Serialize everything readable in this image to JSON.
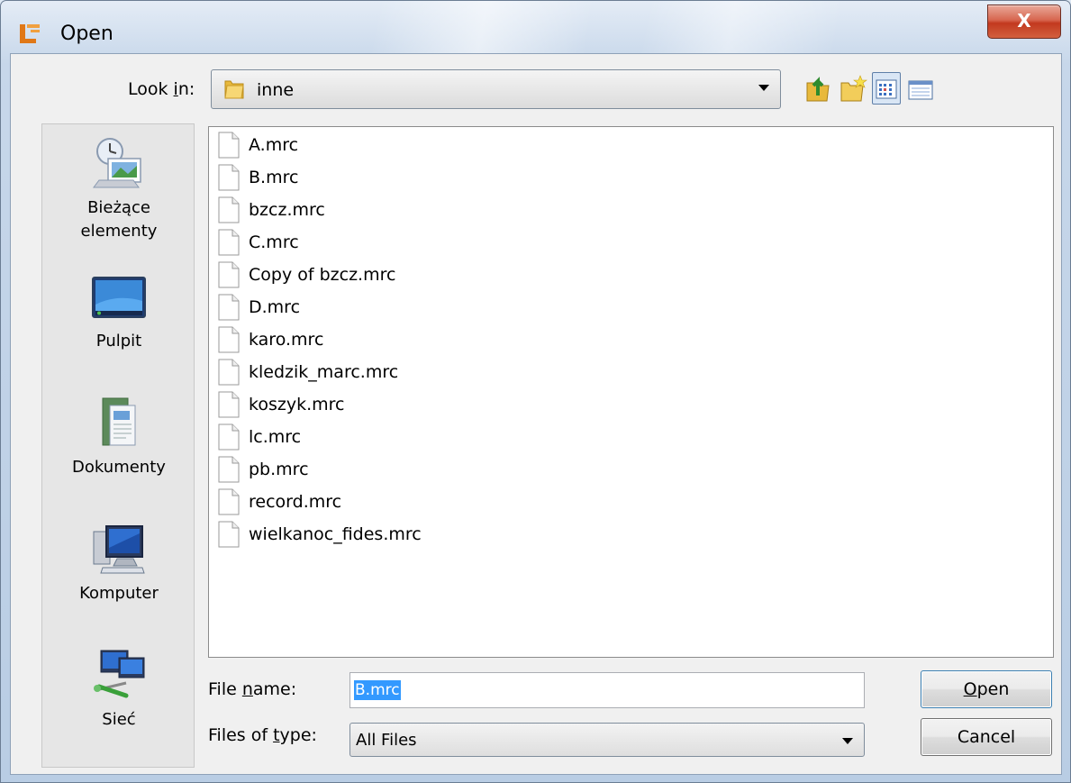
{
  "window": {
    "title": "Open",
    "close_label": "X"
  },
  "toolbar": {
    "lookin_label_pre": "Look ",
    "lookin_label_key": "i",
    "lookin_label_post": "n:",
    "lookin_value": "inne"
  },
  "places": [
    {
      "line1": "Bieżące",
      "line2": "elementy"
    },
    {
      "line1": "Pulpit"
    },
    {
      "line1": "Dokumenty"
    },
    {
      "line1": "Komputer"
    },
    {
      "line1": "Sieć"
    }
  ],
  "files": [
    "A.mrc",
    "B.mrc",
    "bzcz.mrc",
    "C.mrc",
    "Copy of bzcz.mrc",
    "D.mrc",
    "karo.mrc",
    "kledzik_marc.mrc",
    "koszyk.mrc",
    "lc.mrc",
    "pb.mrc",
    "record.mrc",
    "wielkanoc_fides.mrc"
  ],
  "form": {
    "filename_label_pre": "File ",
    "filename_label_key": "n",
    "filename_label_post": "ame:",
    "filename_value": "B.mrc",
    "filetype_label_pre": "Files of ",
    "filetype_label_key": "t",
    "filetype_label_post": "ype:",
    "filetype_value": "All Files"
  },
  "buttons": {
    "open_key": "O",
    "open_rest": "pen",
    "cancel": "Cancel"
  }
}
